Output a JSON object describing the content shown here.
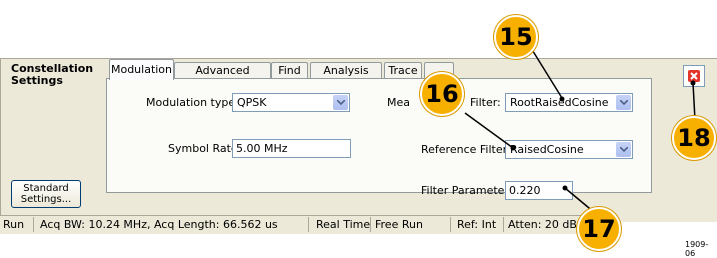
{
  "panel": {
    "title": "Constellation Settings"
  },
  "tabs": [
    {
      "label": "Modulation",
      "active": true
    },
    {
      "label": "Advanced Params",
      "active": false
    },
    {
      "label": "Find",
      "active": false
    },
    {
      "label": "Analysis Time",
      "active": false
    },
    {
      "label": "Trace",
      "active": false
    },
    {
      "label": "",
      "active": false
    }
  ],
  "fields": {
    "modulation_type": {
      "label": "Modulation type:",
      "value": "QPSK"
    },
    "symbol_rate": {
      "label": "Symbol Rate:",
      "value": "5.00 MHz"
    },
    "measurement_filter": {
      "label_start": "Mea",
      "label_end": "Filter:",
      "value": "RootRaisedCosine"
    },
    "reference_filter": {
      "label": "Reference Filter:",
      "value": "RaisedCosine"
    },
    "filter_parameter": {
      "label": "Filter Parameter:",
      "value": "0.220"
    }
  },
  "buttons": {
    "standard_settings": "Standard Settings..."
  },
  "statusbar": {
    "run": "Run",
    "acq": "Acq BW: 10.24 MHz, Acq Length: 66.562 us",
    "realtime": "Real Time",
    "freerun": "Free Run",
    "ref": "Ref: Int",
    "atten": "Atten: 20 dB"
  },
  "callouts": [
    "15",
    "16",
    "17",
    "18"
  ],
  "figure_number": "1909-06",
  "colors": {
    "callout": "#f7b000",
    "close": "#e3342c",
    "panel": "#ece9d8"
  }
}
